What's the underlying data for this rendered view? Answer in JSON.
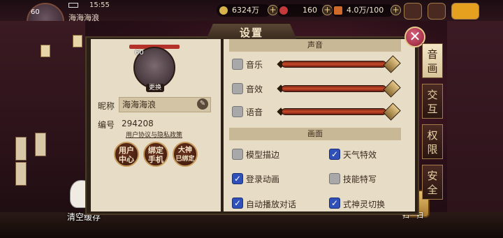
{
  "hud": {
    "time": "15:55",
    "player_name": "海海海浪",
    "level": "60",
    "gold": "6324万",
    "jade": "160",
    "stamina": "4.0万/100"
  },
  "window": {
    "title": "设置",
    "close_glyph": "✕"
  },
  "profile": {
    "level": "60",
    "change_avatar": "更换",
    "nickname_label": "昵称",
    "nickname": "海海海浪",
    "id_label": "编号",
    "id": "294208",
    "policy_link": "用户协议与隐私政策",
    "buttons": [
      {
        "line1": "用户",
        "line2": "中心"
      },
      {
        "line1": "绑定",
        "line2": "手机"
      },
      {
        "line1": "大神",
        "line2": "已绑定"
      }
    ]
  },
  "sound": {
    "header": "声音",
    "items": [
      {
        "label": "音乐",
        "checked": false,
        "volume": 1.0
      },
      {
        "label": "音效",
        "checked": false,
        "volume": 1.0
      },
      {
        "label": "语音",
        "checked": false,
        "volume": 1.0
      }
    ]
  },
  "graphics": {
    "header": "画面",
    "items": [
      {
        "label": "模型描边",
        "checked": false
      },
      {
        "label": "天气特效",
        "checked": true
      },
      {
        "label": "登录动画",
        "checked": true
      },
      {
        "label": "技能特写",
        "checked": false
      },
      {
        "label": "自动播放对话",
        "checked": true
      },
      {
        "label": "式神灵切换",
        "checked": true
      }
    ]
  },
  "tabs": [
    {
      "label_top": "音",
      "label_bottom": "画",
      "active": true
    },
    {
      "label_top": "交",
      "label_bottom": "互",
      "active": false
    },
    {
      "label_top": "权",
      "label_bottom": "限",
      "active": false
    },
    {
      "label_top": "安",
      "label_bottom": "全",
      "active": false
    }
  ],
  "bottom": {
    "clear_cache": "清空缓存",
    "scan": "扫一扫"
  },
  "colors": {
    "accent": "#2f50b8",
    "panel": "#e7dcc6",
    "slider": "#c84a28"
  }
}
